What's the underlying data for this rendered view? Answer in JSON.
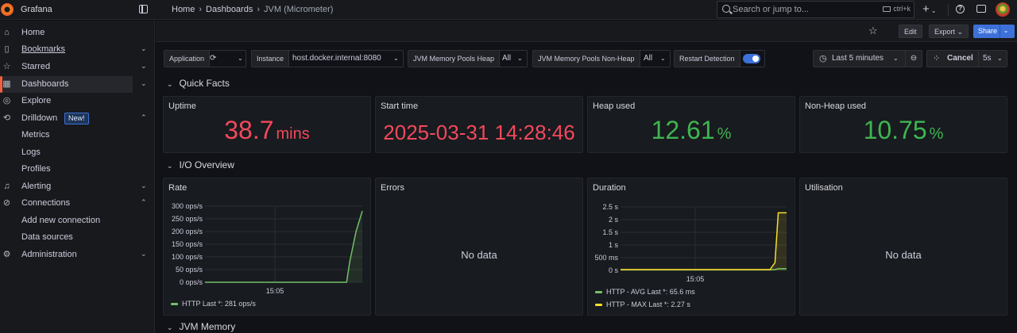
{
  "topbar": {
    "brand": "Grafana",
    "breadcrumbs": [
      "Home",
      "Dashboards",
      "JVM (Micrometer)"
    ],
    "search_placeholder": "Search or jump to...",
    "search_shortcut": "ctrl+k"
  },
  "sidebar": {
    "items": [
      {
        "label": "Home",
        "icon": "home-icon"
      },
      {
        "label": "Bookmarks",
        "icon": "bookmark-icon"
      },
      {
        "label": "Starred",
        "icon": "star-icon"
      },
      {
        "label": "Dashboards",
        "icon": "dashboards-icon"
      },
      {
        "label": "Explore",
        "icon": "compass-icon"
      },
      {
        "label": "Drilldown",
        "icon": "drilldown-icon",
        "badge": "New!"
      },
      {
        "label": "Metrics"
      },
      {
        "label": "Logs"
      },
      {
        "label": "Profiles"
      },
      {
        "label": "Alerting",
        "icon": "bell-icon"
      },
      {
        "label": "Connections",
        "icon": "plug-icon"
      },
      {
        "label": "Add new connection"
      },
      {
        "label": "Data sources"
      },
      {
        "label": "Administration",
        "icon": "gear-icon"
      }
    ]
  },
  "toolbar": {
    "edit_label": "Edit",
    "export_label": "Export",
    "share_label": "Share"
  },
  "variables": {
    "application_label": "Application",
    "instance_label": "Instance",
    "instance_value": "host.docker.internal:8080",
    "heap_label": "JVM Memory Pools Heap",
    "heap_value": "All",
    "nonheap_label": "JVM Memory Pools Non-Heap",
    "nonheap_value": "All",
    "restart_label": "Restart Detection",
    "restart_enabled": true
  },
  "timepicker": {
    "range": "Last 5 minutes",
    "cancel_label": "Cancel",
    "refresh": "5s"
  },
  "rows": {
    "quick_facts": "Quick Facts",
    "io_overview": "I/O Overview",
    "jvm_memory": "JVM Memory"
  },
  "stats": {
    "uptime": {
      "title": "Uptime",
      "value": "38.7",
      "unit": "mins"
    },
    "start_time": {
      "title": "Start time",
      "value": "2025-03-31 14:28:46"
    },
    "heap_used": {
      "title": "Heap used",
      "value": "12.61",
      "unit": "%"
    },
    "nonheap_used": {
      "title": "Non-Heap used",
      "value": "10.75",
      "unit": "%"
    }
  },
  "panels": {
    "rate_title": "Rate",
    "errors_title": "Errors",
    "duration_title": "Duration",
    "utilisation_title": "Utilisation",
    "no_data": "No data"
  },
  "colors": {
    "stat_red": "#f2495c",
    "stat_green": "#3fb550",
    "avg_series": "#73bf69",
    "max_series": "#fade2a",
    "accent": "#3d71d9"
  },
  "chart_data": [
    {
      "type": "line",
      "panel": "Rate",
      "y_ticks": [
        "300 ops/s",
        "250 ops/s",
        "200 ops/s",
        "150 ops/s",
        "100 ops/s",
        "50 ops/s",
        "0 ops/s"
      ],
      "ylim": [
        0,
        300
      ],
      "x_ticks": [
        "15:05"
      ],
      "grid": true,
      "series": [
        {
          "name": "HTTP",
          "legend": "HTTP  Last *: 281 ops/s",
          "color": "#73bf69",
          "points": [
            [
              0,
              0
            ],
            [
              0.2,
              0
            ],
            [
              0.4,
              0
            ],
            [
              0.6,
              0
            ],
            [
              0.8,
              0
            ],
            [
              0.9,
              0
            ],
            [
              0.92,
              80
            ],
            [
              0.96,
              200
            ],
            [
              1.0,
              281
            ]
          ]
        }
      ]
    },
    {
      "type": "line",
      "panel": "Duration",
      "y_ticks": [
        "2.5 s",
        "2 s",
        "1.5 s",
        "1 s",
        "500 ms",
        "0 s"
      ],
      "ylim": [
        0,
        2.5
      ],
      "x_ticks": [
        "15:05"
      ],
      "grid": true,
      "series": [
        {
          "name": "HTTP - AVG",
          "legend": "HTTP - AVG  Last *: 65.6 ms",
          "color": "#73bf69",
          "points": [
            [
              0,
              0.02
            ],
            [
              0.5,
              0.02
            ],
            [
              0.9,
              0.02
            ],
            [
              0.93,
              0.03
            ],
            [
              0.95,
              0.066
            ],
            [
              1.0,
              0.066
            ]
          ]
        },
        {
          "name": "HTTP - MAX",
          "legend": "HTTP - MAX  Last *: 2.27 s",
          "color": "#fade2a",
          "points": [
            [
              0,
              0.03
            ],
            [
              0.5,
              0.03
            ],
            [
              0.9,
              0.03
            ],
            [
              0.93,
              0.3
            ],
            [
              0.95,
              2.27
            ],
            [
              1.0,
              2.27
            ]
          ]
        }
      ]
    }
  ]
}
